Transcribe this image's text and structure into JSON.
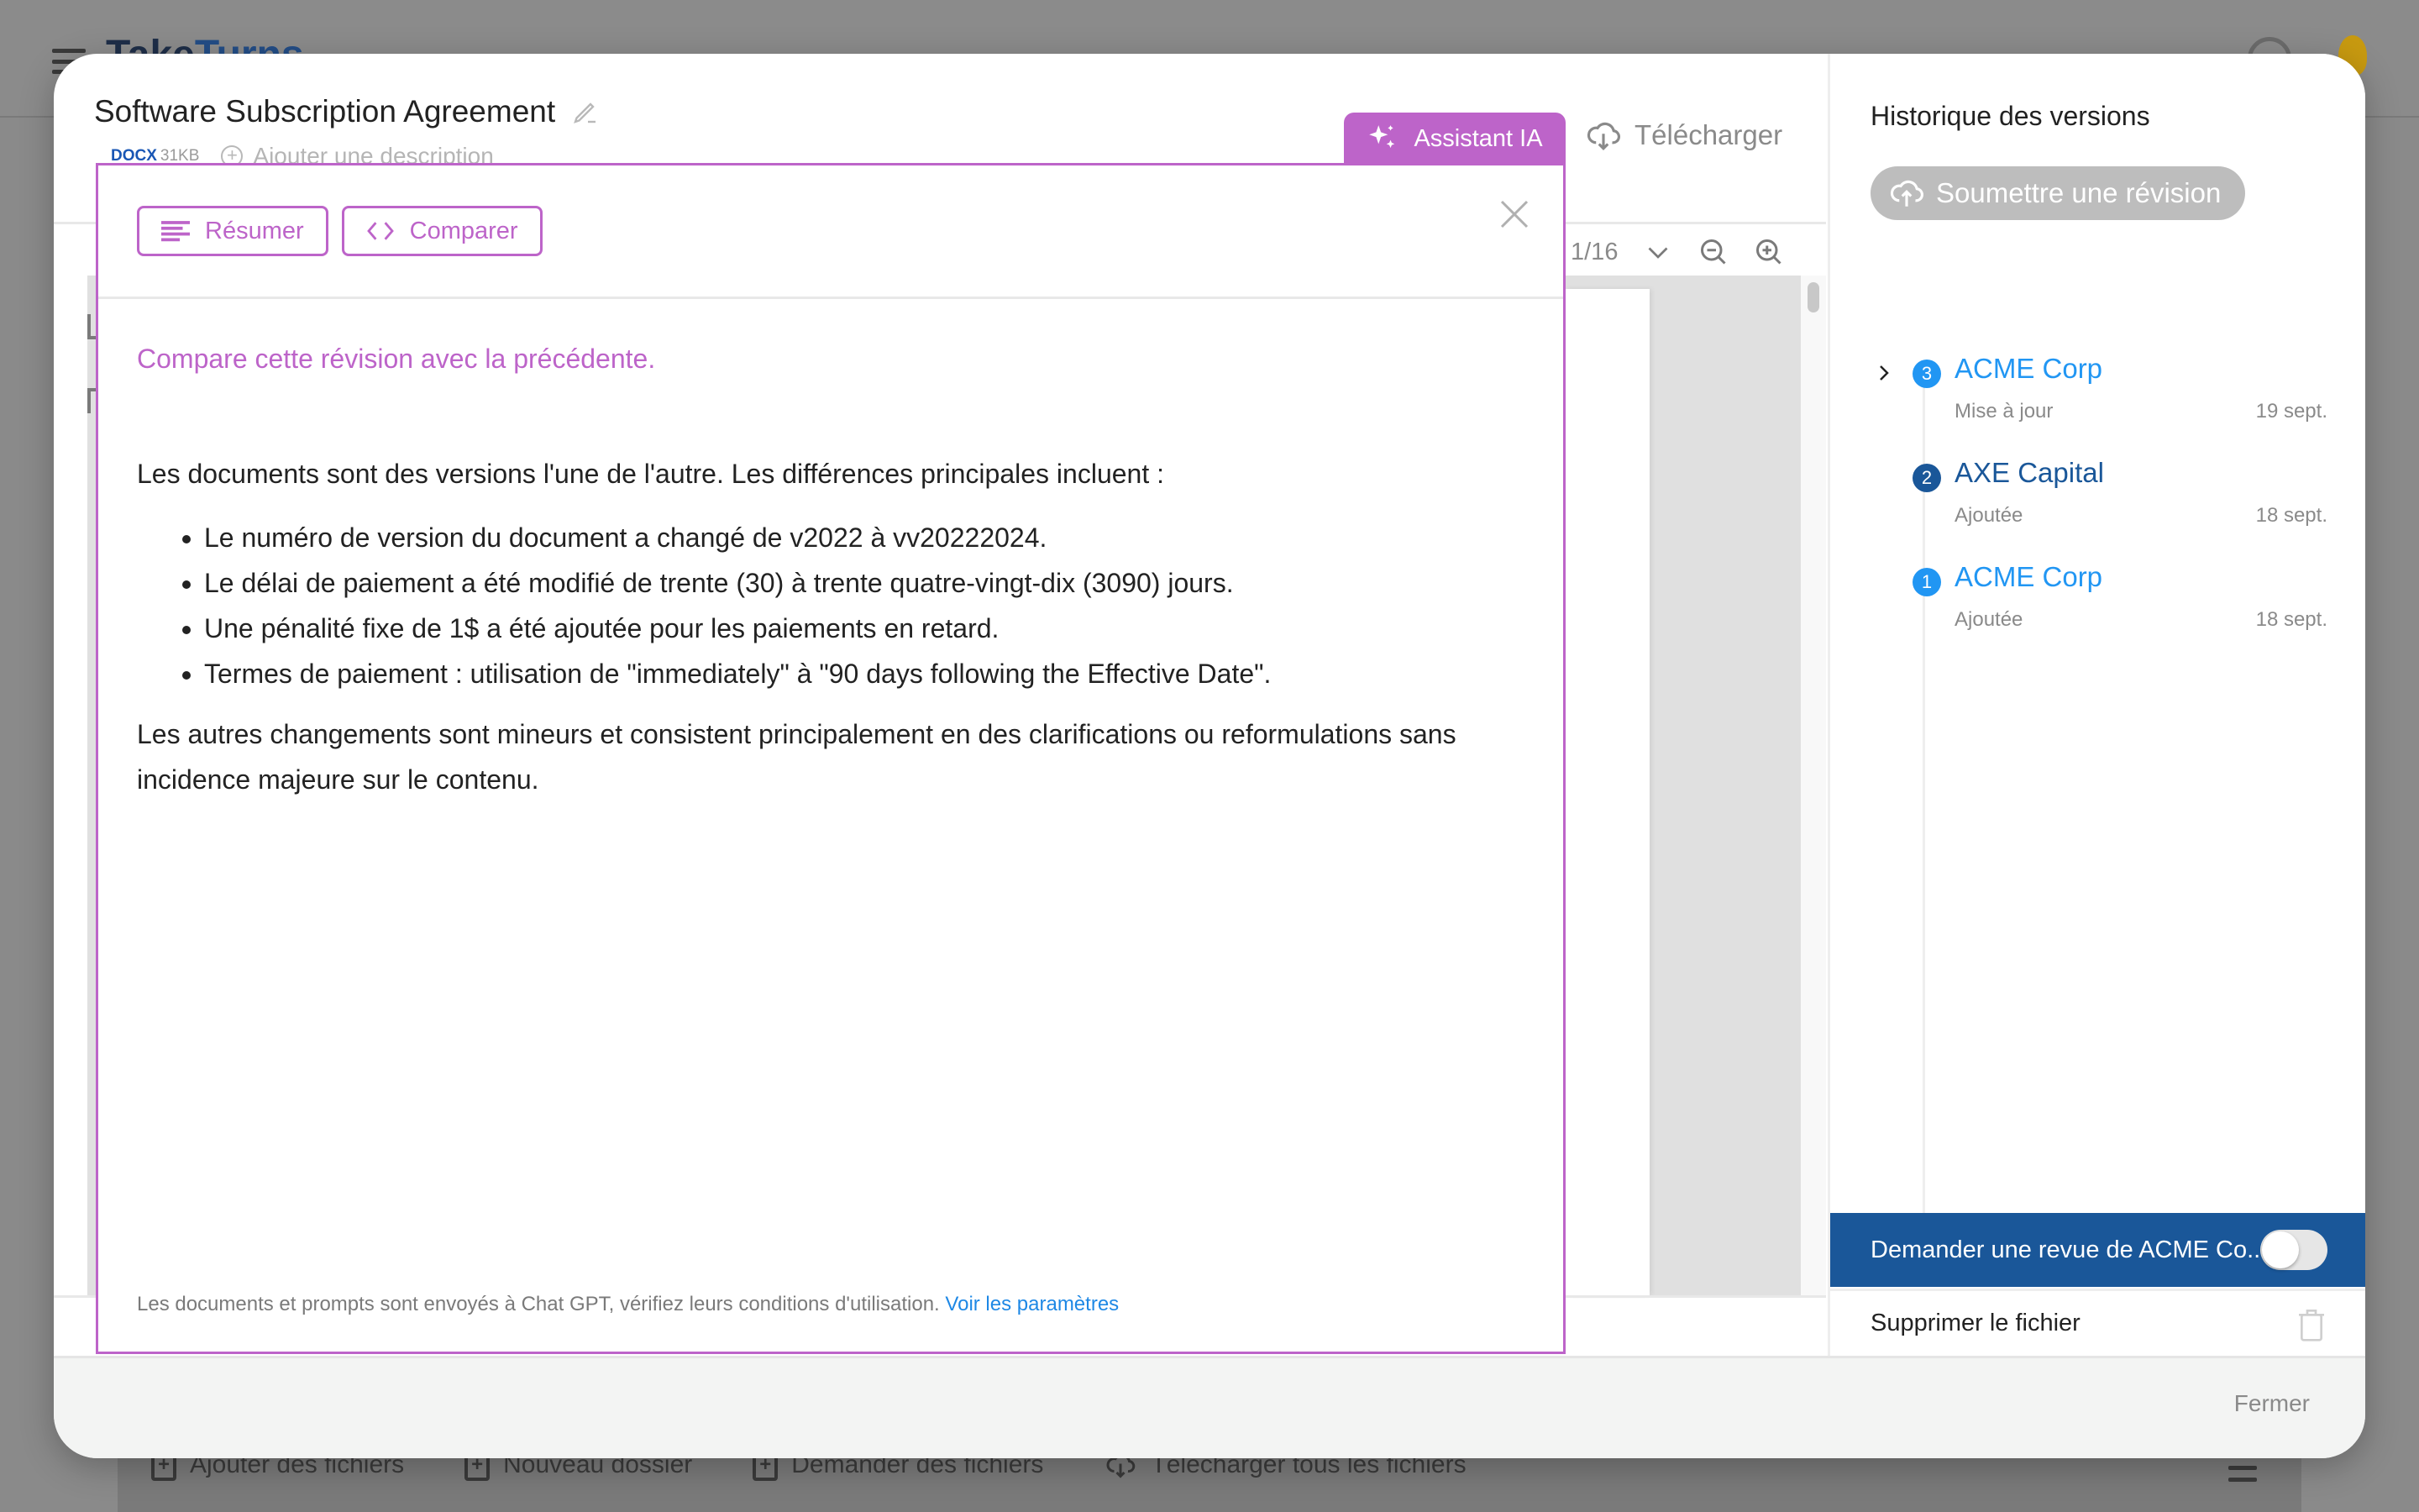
{
  "background": {
    "app_name_part1": "Take",
    "app_name_part2": "Turns",
    "bottom_bar": [
      {
        "label": "Ajouter des fichiers",
        "icon": "file-plus-icon"
      },
      {
        "label": "Nouveau dossier",
        "icon": "folder-plus-icon"
      },
      {
        "label": "Demander des fichiers",
        "icon": "request-plus-icon"
      },
      {
        "label": "Télécharger tous les fichiers",
        "icon": "cloud-download-icon"
      }
    ]
  },
  "document": {
    "title": "Software Subscription Agreement",
    "file_type": "DOCX",
    "file_size": "31KB",
    "description_placeholder": "Ajouter une description",
    "ai_tab_label": "Assistant IA",
    "download_label": "Télécharger",
    "page_indicator": "1/16"
  },
  "ai_panel": {
    "actions": [
      {
        "label": "Résumer",
        "icon": "lines-icon"
      },
      {
        "label": "Comparer",
        "icon": "code-brackets-icon"
      }
    ],
    "prompt": "Compare cette révision avec la précédente.",
    "response": {
      "intro": "Les documents sont des versions l'une de l'autre. Les différences principales incluent :",
      "bullets": [
        "Le numéro de version du document a changé de v2022 à vv20222024.",
        "Le délai de paiement a été modifié de trente (30) à trente quatre-vingt-dix (3090) jours.",
        "Une pénalité fixe de 1$ a été ajoutée pour les paiements en retard.",
        "Termes de paiement : utilisation de \"immediately\" à \"90 days following the Effective Date\"."
      ],
      "conclusion": "Les autres changements sont mineurs et consistent principalement en des clarifications ou reformulations sans incidence majeure sur le contenu."
    },
    "disclaimer": "Les documents et prompts sont envoyés à Chat GPT, vérifiez leurs conditions d'utilisation.",
    "settings_link": "Voir les paramètres"
  },
  "version_history": {
    "title": "Historique des versions",
    "submit_label": "Soumettre une révision",
    "versions": [
      {
        "number": "3",
        "name": "ACME Corp",
        "action": "Mise à jour",
        "date": "19 sept.",
        "color": "#2196f3",
        "expandable": true
      },
      {
        "number": "2",
        "name": "AXE Capital",
        "action": "Ajoutée",
        "date": "18 sept.",
        "color": "#1a5799",
        "expandable": false
      },
      {
        "number": "1",
        "name": "ACME Corp",
        "action": "Ajoutée",
        "date": "18 sept.",
        "color": "#2196f3",
        "expandable": false
      }
    ],
    "review_request_label": "Demander une revue de ACME Co...",
    "review_toggle_on": false,
    "delete_label": "Supprimer le fichier"
  },
  "footer": {
    "close_label": "Fermer"
  },
  "colors": {
    "accent_purple": "#bd64c9",
    "primary_blue": "#1a5799",
    "link_blue": "#1e88e5",
    "version_blue": "#2196f3"
  }
}
